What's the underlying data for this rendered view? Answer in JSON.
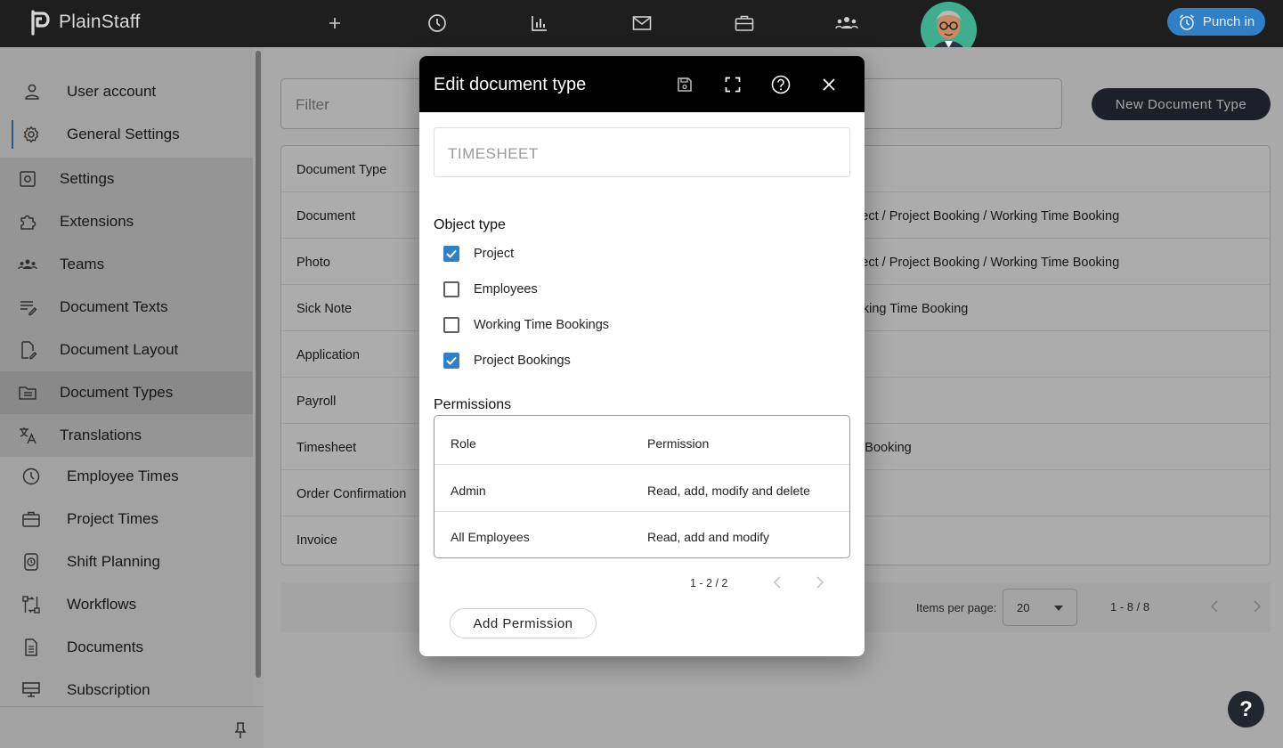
{
  "app": {
    "name": "PlainStaff",
    "punch_label": "Punch in",
    "accent": "#2f80c6"
  },
  "topnav": [
    {
      "name": "add-icon"
    },
    {
      "name": "clock-icon"
    },
    {
      "name": "chart-icon"
    },
    {
      "name": "mail-icon"
    },
    {
      "name": "briefcase-icon"
    },
    {
      "name": "team-icon"
    }
  ],
  "sidebar": {
    "items": [
      {
        "label": "User account",
        "icon": "user-icon"
      },
      {
        "label": "General Settings",
        "icon": "gear-icon"
      },
      {
        "label": "Settings",
        "icon": "settings-box-icon"
      },
      {
        "label": "Extensions",
        "icon": "puzzle-icon"
      },
      {
        "label": "Teams",
        "icon": "team-icon"
      },
      {
        "label": "Document Texts",
        "icon": "text-edit-icon"
      },
      {
        "label": "Document Layout",
        "icon": "document-edit-icon"
      },
      {
        "label": "Document Types",
        "icon": "folder-icon"
      },
      {
        "label": "Translations",
        "icon": "translate-icon"
      },
      {
        "label": "Employee Times",
        "icon": "clock-icon"
      },
      {
        "label": "Project Times",
        "icon": "briefcase-icon"
      },
      {
        "label": "Shift Planning",
        "icon": "alarm-icon"
      },
      {
        "label": "Workflows",
        "icon": "workflow-icon"
      },
      {
        "label": "Documents",
        "icon": "document-icon"
      },
      {
        "label": "Subscription",
        "icon": "monitor-icon"
      }
    ]
  },
  "main": {
    "filter_placeholder": "Filter",
    "new_button": "New Document Type",
    "table": {
      "header": {
        "c1": "Document Type",
        "c2": ""
      },
      "rows": [
        {
          "c1": "Document",
          "c2": "oject / Project Booking / Working Time Booking"
        },
        {
          "c1": "Photo",
          "c2": "oject / Project Booking / Working Time Booking"
        },
        {
          "c1": "Sick Note",
          "c2": "orking Time Booking"
        },
        {
          "c1": "Application",
          "c2": ""
        },
        {
          "c1": "Payroll",
          "c2": ""
        },
        {
          "c1": "Timesheet",
          "c2": "ct Booking"
        },
        {
          "c1": "Order Confirmation",
          "c2": ""
        },
        {
          "c1": "Invoice",
          "c2": ""
        }
      ]
    },
    "pager": {
      "items_per_page_label": "Items per page:",
      "items_per_page": "20",
      "range": "1 - 8 / 8"
    }
  },
  "dialog": {
    "title": "Edit document type",
    "name_value": "TIMESHEET",
    "object_type_title": "Object type",
    "object_types": [
      {
        "label": "Project",
        "checked": true
      },
      {
        "label": "Employees",
        "checked": false
      },
      {
        "label": "Working Time Bookings",
        "checked": false
      },
      {
        "label": "Project Bookings",
        "checked": true
      }
    ],
    "permissions_title": "Permissions",
    "permissions": {
      "header": {
        "role": "Role",
        "permission": "Permission"
      },
      "rows": [
        {
          "role": "Admin",
          "permission": "Read, add, modify and delete"
        },
        {
          "role": "All Employees",
          "permission": "Read, add and modify"
        }
      ],
      "range": "1 - 2 / 2"
    },
    "add_permission": "Add Permission"
  },
  "help_fab": "?"
}
